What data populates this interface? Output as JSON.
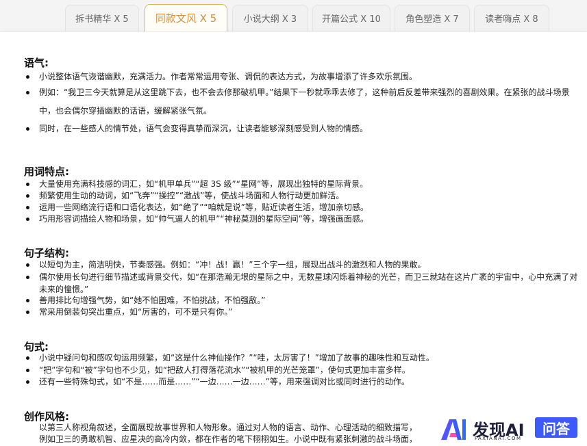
{
  "tabs": [
    {
      "label": "拆书精华 X 5"
    },
    {
      "label": "同款文风 X 5"
    },
    {
      "label": "小说大纲 X 3"
    },
    {
      "label": "开篇公式 X 10"
    },
    {
      "label": "角色塑造 X 7"
    },
    {
      "label": "读者嗨点 X 8"
    }
  ],
  "active_tab": 1,
  "sections": [
    {
      "title": "语气:",
      "items": [
        "小说整体语气诙谐幽默，充满活力。作者常常运用夸张、调侃的表达方式，为故事增添了许多欢乐氛围。",
        "例如：“我卫三今天就算是从这里跳下去，也不会去修那破机甲。”结果下一秒就乖乖去修了，这种前后反差带来强烈的喜剧效果。在紧张的战斗场景中，也会偶尔穿插幽默的话语，缓解紧张气氛。",
        "同时，在一些感人的情节处，语气会变得真挚而深沉，让读者能够深刻感受到人物的情感。"
      ]
    },
    {
      "title": "用词特点:",
      "items": [
        "大量使用充满科技感的词汇，如“机甲单兵”“超 3S 级”“星网”等，展现出独特的星际背景。",
        "频繁使用生动的动词，如“飞奔”“操控”“激战”等，使战斗场面和人物行动更加鲜活。",
        "运用一些网络流行语和口语化表达，如“绝了”“咱就是说”等，贴近读者生活，增加亲切感。",
        "巧用形容词描绘人物和场景，如“帅气逼人的机甲”“神秘莫测的星际空间”等，增强画面感。"
      ]
    },
    {
      "title": "句子结构:",
      "items": [
        "以短句为主，简洁明快，节奏感强。例如：“冲！战！赢！”三个字一组，展现出战斗的激烈和人物的果敢。",
        "偶尔使用长句进行细节描述或背景交代，如“在那浩瀚无垠的星际之中，无数星球闪烁着神秘的光芒，而卫三就站在这片广袤的宇宙中，心中充满了对未来的憧憬。”",
        "善用排比句增强气势，如“她不怕困难，不怕挑战，不怕强敌。”",
        "常采用倒装句突出重点，如“厉害的，可不是只有你。”"
      ]
    },
    {
      "title": "句式:",
      "items": [
        "小说中疑问句和感叹句运用频繁，如“这是什么神仙操作？”“哇，太厉害了！”增加了故事的趣味性和互动性。",
        "“把”字句和“被”字句也不少见，如“把敌人打得落花流水”“被机甲的光芒笼罩”，使句式更加丰富多样。",
        "还有一些特殊句式，如“不是……而是……”“一边……一边……”等，用来强调对比或同时进行的动作。"
      ]
    },
    {
      "title": "创作风格:",
      "items": [
        "以第三人称视角叙述，全面展现故事世界和人物形象。通过对人物的语言、动作、心理活动的细致描写，",
        "例如卫三的勇敢机智、应星决的高冷内敛，都在作者的笔下栩栩如生。小说中既有紧张刺激的战斗场面，"
      ]
    }
  ],
  "watermark": {
    "name": "发现AI",
    "sub": "FAXIANAI.COM",
    "badge": "问答"
  },
  "colors": {
    "active_tab_border": "#e6b25a",
    "active_tab_text": "#d4913b",
    "badge": "#3d5afe"
  }
}
